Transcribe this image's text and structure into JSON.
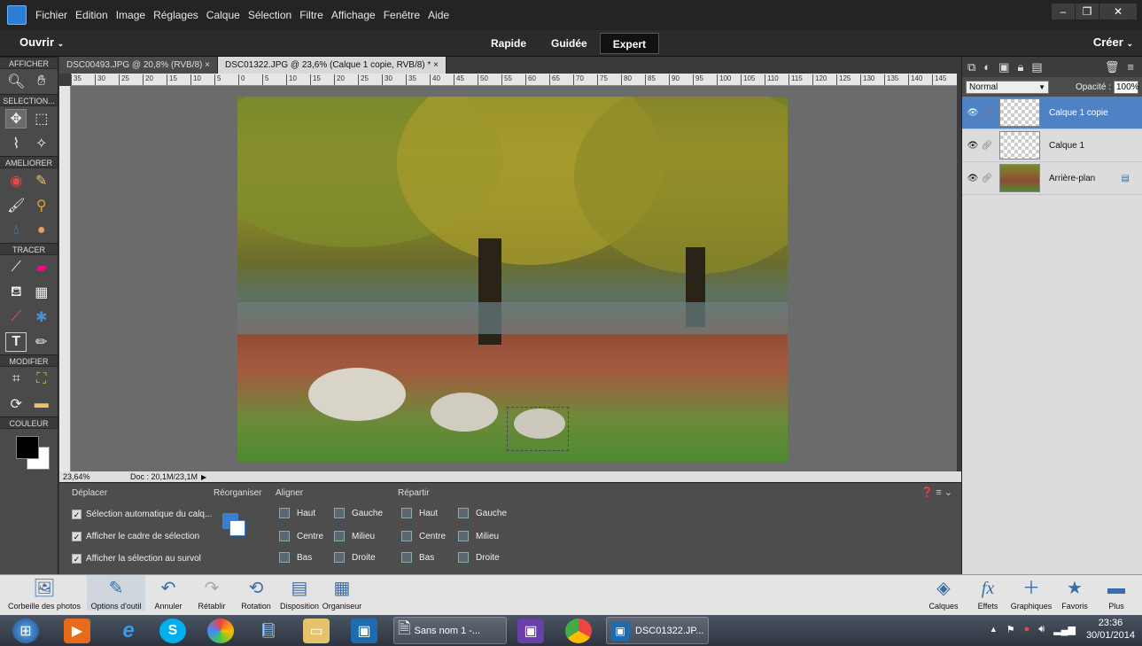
{
  "menubar": {
    "items": [
      "Fichier",
      "Edition",
      "Image",
      "Réglages",
      "Calque",
      "Sélection",
      "Filtre",
      "Affichage",
      "Fenêtre",
      "Aide"
    ]
  },
  "modebar": {
    "open_label": "Ouvrir",
    "modes": [
      "Rapide",
      "Guidée",
      "Expert"
    ],
    "active_mode": "Expert",
    "create_label": "Créer"
  },
  "toolbox": {
    "sections": [
      "AFFICHER",
      "SELECTION...",
      "AMELIORER",
      "TRACER",
      "MODIFIER",
      "COULEUR"
    ]
  },
  "tabs": [
    {
      "label": "DSC00493.JPG @ 20,8% (RVB/8) ×"
    },
    {
      "label": "DSC01322.JPG @ 23,6% (Calque 1 copie, RVB/8) * ×"
    }
  ],
  "ruler": {
    "labels": [
      "35",
      "30",
      "25",
      "20",
      "15",
      "10",
      "5",
      "0",
      "5",
      "10",
      "15",
      "20",
      "25",
      "30",
      "35",
      "40",
      "45",
      "50",
      "55",
      "60",
      "65",
      "70",
      "75",
      "80",
      "85",
      "90",
      "95",
      "100",
      "105",
      "110",
      "115",
      "120",
      "125",
      "130",
      "135",
      "140",
      "145"
    ]
  },
  "status": {
    "zoom": "23,64%",
    "doc": "Doc : 20,1M/23,1M"
  },
  "options": {
    "move_title": "Déplacer",
    "auto_select": "Sélection automatique du calq...",
    "show_bounding": "Afficher le cadre de sélection",
    "show_hover": "Afficher la sélection au survol",
    "arrange_title": "Réorganiser",
    "align_title": "Aligner",
    "align": [
      "Haut",
      "Gauche",
      "Centre",
      "Milieu",
      "Bas",
      "Droite"
    ],
    "distribute_title": "Répartir",
    "distribute": [
      "Haut",
      "Gauche",
      "Centre",
      "Milieu",
      "Bas",
      "Droite"
    ]
  },
  "layers_panel": {
    "blend_mode": "Normal",
    "opacity_label": "Opacité :",
    "opacity_value": "100%",
    "layers": [
      {
        "name": "Calque 1 copie",
        "selected": true
      },
      {
        "name": "Calque 1",
        "selected": false
      },
      {
        "name": "Arrière-plan",
        "selected": false
      }
    ]
  },
  "bottombar": {
    "left": [
      "Corbeille des photos",
      "Options d'outil",
      "Annuler",
      "Rétablir",
      "Rotation",
      "Disposition",
      "Organiseur"
    ],
    "right": [
      "Calques",
      "Effets",
      "Graphiques",
      "Favoris",
      "Plus"
    ]
  },
  "taskbar": {
    "window1": "Sans nom 1 -...",
    "window2": "DSC01322.JP...",
    "time": "23:36",
    "date": "30/01/2014"
  },
  "colors": {
    "selected_layer": "#4f82c5",
    "accent": "#3a6ea8"
  }
}
